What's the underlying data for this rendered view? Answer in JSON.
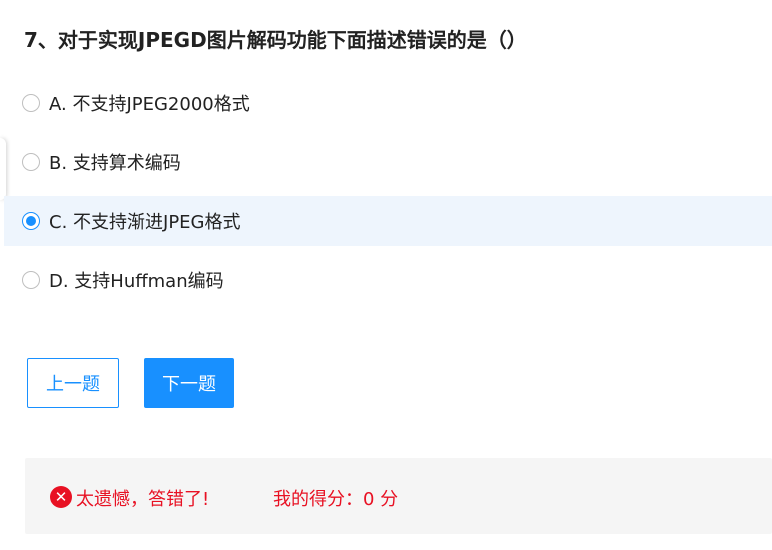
{
  "question": {
    "title": "7、对于实现JPEGD图片解码功能下面描述错误的是（）"
  },
  "options": [
    {
      "label": "A. 不支持JPEG2000格式",
      "selected": false
    },
    {
      "label": "B. 支持算术编码",
      "selected": false
    },
    {
      "label": "C. 不支持渐进JPEG格式",
      "selected": true
    },
    {
      "label": "D. 支持Huffman编码",
      "selected": false
    }
  ],
  "buttons": {
    "prev_label": "上一题",
    "next_label": "下一题"
  },
  "result": {
    "icon": "close-circle-icon",
    "icon_glyph": "✕",
    "message": "太遗憾，答错了!",
    "score_text": "我的得分：0 分"
  },
  "colors": {
    "accent": "#1890ff",
    "selected_bg": "#eef5fd",
    "error": "#e81123",
    "panel_bg": "#f5f5f5"
  }
}
